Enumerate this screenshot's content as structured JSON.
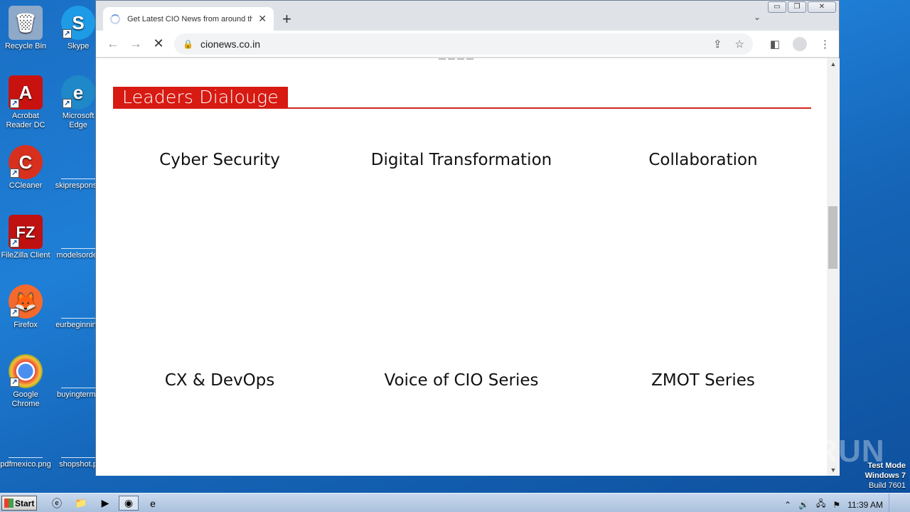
{
  "desktop": {
    "icons": [
      {
        "label": "Recycle Bin",
        "glyph": "🗑",
        "color": "#8fa9c9",
        "icon": "recycle-bin-icon"
      },
      {
        "label": "Skype",
        "glyph": "S",
        "color": "#1d9be6",
        "icon": "skype-icon"
      },
      {
        "label": "Acrobat Reader DC",
        "glyph": "A",
        "color": "#c8120f",
        "icon": "acrobat-icon"
      },
      {
        "label": "Microsoft Edge",
        "glyph": "e",
        "color": "#1e88c8",
        "icon": "edge-icon"
      },
      {
        "label": "CCleaner",
        "glyph": "C",
        "color": "#d8301f",
        "icon": "ccleaner-icon"
      },
      {
        "label": "skipresponse",
        "glyph": "",
        "color": "",
        "icon": "file-icon"
      },
      {
        "label": "FileZilla Client",
        "glyph": "FZ",
        "color": "#bf1111",
        "icon": "filezilla-icon"
      },
      {
        "label": "modelsorder",
        "glyph": "",
        "color": "",
        "icon": "file-icon"
      },
      {
        "label": "Firefox",
        "glyph": "🦊",
        "color": "#f56a2c",
        "icon": "firefox-icon"
      },
      {
        "label": "eurbeginning",
        "glyph": "",
        "color": "",
        "icon": "file-icon"
      },
      {
        "label": "Google Chrome",
        "glyph": "◉",
        "color": "#2f8e3c",
        "icon": "chrome-icon"
      },
      {
        "label": "buyingterms",
        "glyph": "",
        "color": "",
        "icon": "file-icon"
      },
      {
        "label": "pdfmexico.png",
        "glyph": "",
        "color": "",
        "icon": "file-icon"
      },
      {
        "label": "shopshot.p",
        "glyph": "",
        "color": "",
        "icon": "file-icon"
      }
    ]
  },
  "browser": {
    "tab_title": "Get Latest CIO News from around the",
    "tab_close": "✕",
    "new_tab": "+",
    "url": "cionews.co.in",
    "back": "←",
    "forward": "→",
    "stop": "✕",
    "window": {
      "minimize": "▭",
      "maximize": "❐",
      "close": "✕"
    }
  },
  "page": {
    "section_title": "Leaders Dialouge",
    "categories": [
      {
        "label": "Cyber Security"
      },
      {
        "label": "Digital Transformation"
      },
      {
        "label": "Collaboration"
      },
      {
        "label": "CX & DevOps"
      },
      {
        "label": "Voice of CIO Series"
      },
      {
        "label": "ZMOT Series"
      }
    ]
  },
  "watermark": "ANY RUN",
  "system": {
    "test_mode_line1": "Test Mode",
    "test_mode_line2": "Windows 7",
    "build": "Build 7601",
    "time": "11:39 AM",
    "start_label": "Start"
  },
  "colors": {
    "accent_red": "#d71a12",
    "desktop_blue": "#1a6fc4"
  }
}
